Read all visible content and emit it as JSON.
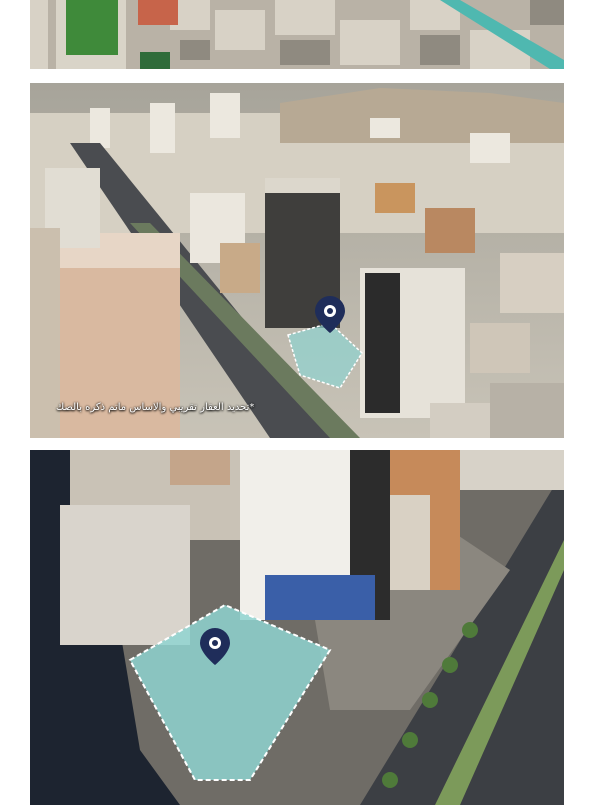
{
  "caption": "*تحديد العقار تقريبي والاساس ماتم ذكره بالصك",
  "colors": {
    "parcel_fill": "#8fd3d0",
    "pin": "#1f2d5a",
    "road": "#3c3f44"
  },
  "icons": {
    "pin_top": "location-pin-icon",
    "pin_bottom": "location-pin-icon"
  }
}
